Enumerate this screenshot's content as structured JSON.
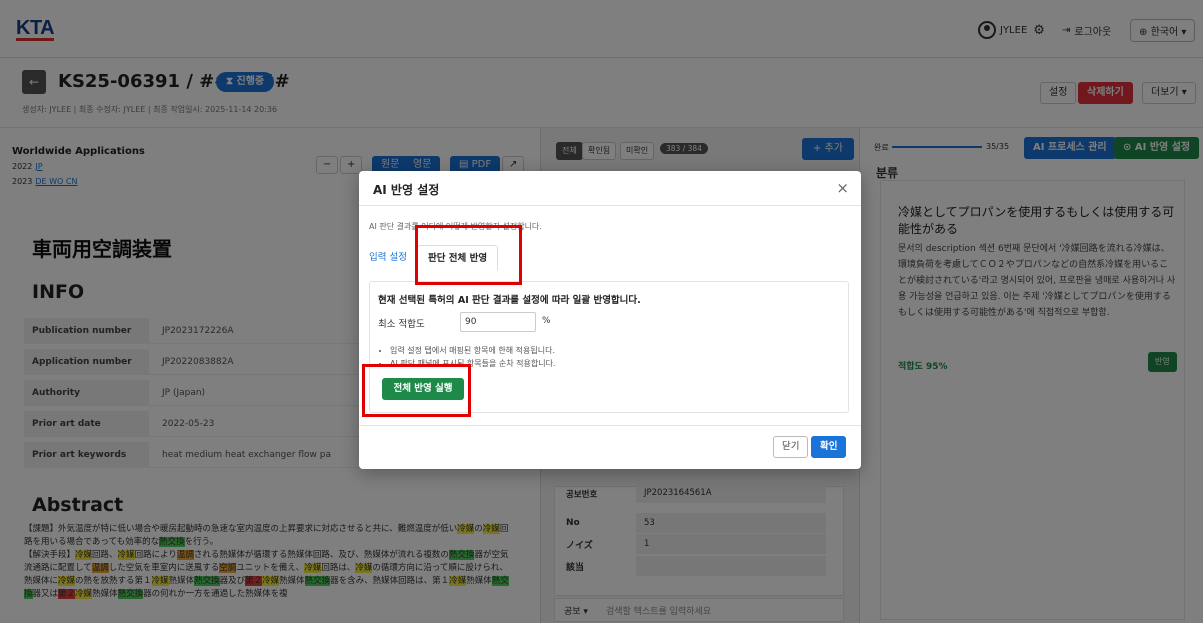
{
  "topbar": {
    "logo": "KTA",
    "user": "JYLEE",
    "logout": "로그아웃",
    "language": "한국어"
  },
  "doc": {
    "id": "KS25-06391 / ######",
    "status": "진행중",
    "meta": "생성자: JYLEE   |   최종 수정자: JYLEE   |   최종 작업일시: 2025-11-14 20:36"
  },
  "actions": {
    "settings": "설정",
    "delete": "삭제하기",
    "more": "더보기"
  },
  "worldwide": {
    "title": "Worldwide Applications",
    "years": [
      {
        "year": "2022",
        "codes": "JP"
      },
      {
        "year": "2023",
        "codes": "DE WO CN"
      }
    ]
  },
  "viewer": {
    "minus": "−",
    "plus": "+",
    "original": "원문",
    "english": "영문",
    "pdf": "PDF"
  },
  "patent": {
    "title": "車両用空調装置",
    "info_heading": "INFO",
    "info": [
      {
        "key": "Publication number",
        "value": "JP2023172226A"
      },
      {
        "key": "Application number",
        "value": "JP2022083882A"
      },
      {
        "key": "Authority",
        "value": "JP (Japan)"
      },
      {
        "key": "Prior art date",
        "value": "2022-05-23"
      },
      {
        "key": "Prior art keywords",
        "value": "heat medium   heat exchanger   flow pa"
      }
    ],
    "abstract_heading": "Abstract"
  },
  "mid": {
    "tab_all": "전체",
    "tab_confirmed": "확인됨",
    "tab_unconfirmed": "미확인",
    "count": "383 / 384",
    "add": "+ 추가",
    "fields": [
      {
        "k": "공보번호",
        "v": "JP2023164561A"
      },
      {
        "k": "No",
        "v": "53"
      },
      {
        "k": "ノイズ",
        "v": "1"
      },
      {
        "k": "該当",
        "v": ""
      }
    ],
    "search_scope": "공보",
    "search_placeholder": "검색할 텍스트를 입력하세요"
  },
  "right": {
    "done_label": "완료",
    "progress": "35/35",
    "progress_value": 1.0,
    "ai_process": "AI 프로세스 관리",
    "ai_apply": "AI 반영 설정",
    "section": "분류",
    "card_title": "冷媒としてプロパンを使用するもしくは使用する可能性がある",
    "card_body": "문서의 description 섹션 6번째 문단에서 '冷媒回路を流れる冷媒は、環境負荷を考慮してＣＯ２やプロパンなどの自然系冷媒を用いることが検討されている'라고 명시되어 있어, 프로판을 냉매로 사용하거나 사용 가능성을 언급하고 있음. 이는 주제 '冷媒としてプロパンを使用するもしくは使用する可能性がある'에 직접적으로 부합함.",
    "fit": "적합도 95%",
    "apply": "반영"
  },
  "modal": {
    "title": "AI 반영 설정",
    "close": "×",
    "desc": "AI 판단 결과를 어디에 어떻게 반영할지 설정합니다.",
    "tab_input": "입력 설정",
    "tab_all": "판단 전체 반영",
    "heading": "현재 선택된 특허의 AI 판단 결과를 설정에 따라 일괄 반영합니다.",
    "min_label": "최소 적합도",
    "min_value": "90",
    "unit": "%",
    "notes": [
      "입력 설정 탭에서 매핑된 항목에 한해 적용됩니다.",
      "AI 판단 패널에 표시된 항목들을 순차 적용합니다."
    ],
    "run": "전체 반영 실행",
    "cancel": "닫기",
    "confirm": "확인"
  }
}
